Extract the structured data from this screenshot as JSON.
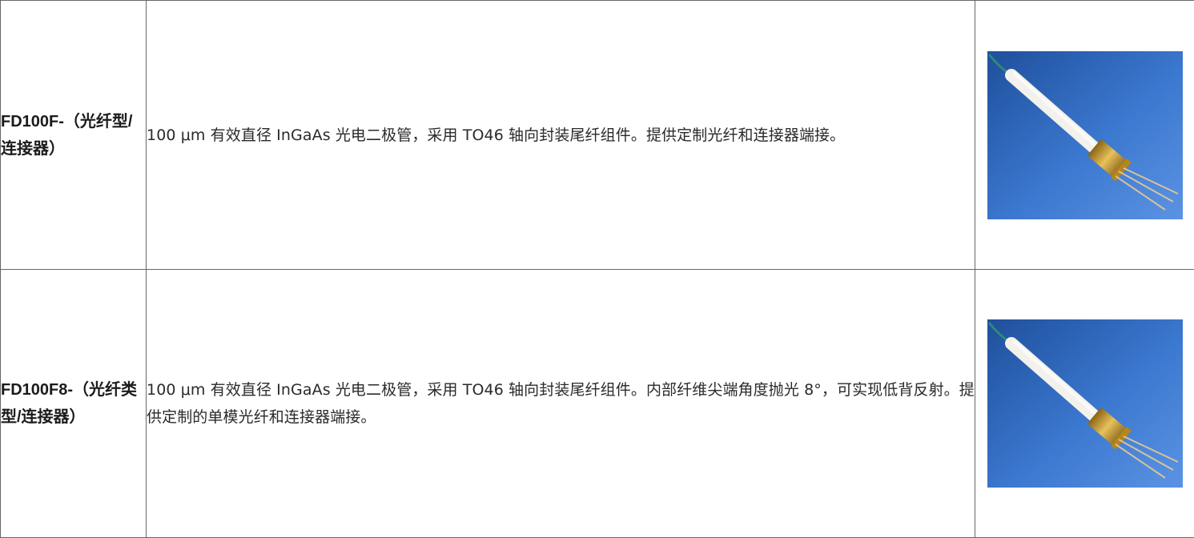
{
  "products": [
    {
      "name": "FD100F-（光纤型/连接器）",
      "description": "100 μm 有效直径 InGaAs 光电二极管，采用 TO46 轴向封装尾纤组件。提供定制光纤和连接器端接。",
      "image": "fiber-pigtailed-photodiode-photo"
    },
    {
      "name": "FD100F8-（光纤类型/连接器）",
      "description": "100 μm 有效直径 InGaAs 光电二极管，采用 TO46 轴向封装尾纤组件。内部纤维尖端角度抛光 8°，可实现低背反射。提供定制的单模光纤和连接器端接。",
      "image": "fiber-pigtailed-photodiode-photo"
    }
  ]
}
